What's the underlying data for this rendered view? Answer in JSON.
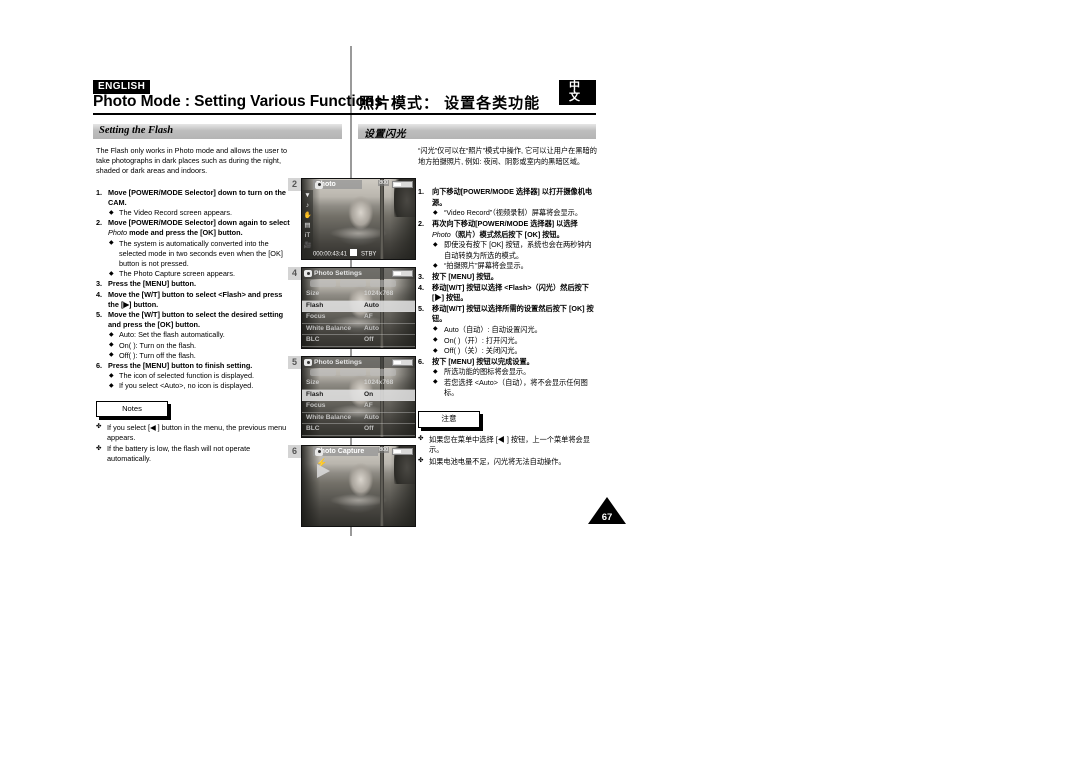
{
  "header": {
    "lang_en": "ENGLISH",
    "lang_cn": "中文",
    "title_en": "Photo Mode : Setting Various Functions",
    "title_cn": "照片模式： 设置各类功能"
  },
  "section": {
    "title_en": "Setting the Flash",
    "title_cn": "设置闪光"
  },
  "english": {
    "intro": "The Flash only works in Photo mode and allows the user to take photographs in dark places such as during the night, shaded or dark areas and indoors.",
    "steps": [
      {
        "num": "1.",
        "text": "Move [POWER/MODE Selector] down to turn on the CAM.",
        "subs": [
          "The Video Record screen appears."
        ]
      },
      {
        "num": "2.",
        "text_a": "Move [POWER/MODE Selector] down again to select ",
        "text_i": "Photo",
        "text_b": " mode and press the [OK] button.",
        "subs": [
          "The system is automatically converted into the selected mode in two seconds even when the [OK] button is not pressed.",
          "The Photo Capture screen appears."
        ]
      },
      {
        "num": "3.",
        "text": "Press the [MENU] button.",
        "subs": []
      },
      {
        "num": "4.",
        "text": "Move the [W/T] button to select <Flash> and press the [▶] button.",
        "subs": []
      },
      {
        "num": "5.",
        "text": "Move the [W/T] button to select the desired setting and press the [OK] button.",
        "subs": [
          "Auto: Set the flash automatically.",
          "On(  ): Turn on the flash.",
          "Off(  ): Turn off the flash."
        ]
      },
      {
        "num": "6.",
        "text": "Press the [MENU] button to finish setting.",
        "subs": [
          "The icon of selected function is displayed.",
          "If you select <Auto>, no icon is displayed."
        ]
      }
    ],
    "notes_label": "Notes",
    "notes": [
      "If you select [◀ ] button in the menu, the previous menu appears.",
      "If the battery is low, the flash will not operate automatically."
    ]
  },
  "chinese": {
    "intro": "“闪光”仅可以在“照片”模式中操作, 它可以让用户在黑暗的地方拍摄照片, 例如: 夜间、阴影或室内的黑暗区域。",
    "steps": [
      {
        "num": "1.",
        "text": "向下移动[POWER/MODE 选择器] 以打开摄像机电源。",
        "subs": [
          "“Video Record”（视频录制）屏幕将会显示。"
        ]
      },
      {
        "num": "2.",
        "text_a": "再次向下移动[POWER/MODE 选择器] 以选择",
        "text_i": "Photo",
        "text_b": "（照片）模式然后按下 [OK] 按钮。",
        "subs": [
          "即使没有按下 [OK] 按钮，系统也会在两秒钟内自动转换为所选的模式。",
          "“拍摄照片”屏幕将会显示。"
        ]
      },
      {
        "num": "3.",
        "text": "按下 [MENU] 按钮。",
        "subs": []
      },
      {
        "num": "4.",
        "text": "移动[W/T] 按钮以选择 <Flash>（闪光）然后按下[▶] 按钮。",
        "subs": []
      },
      {
        "num": "5.",
        "text": "移动[W/T] 按钮以选择所需的设置然后按下 [OK] 按钮。",
        "subs": [
          "Auto（自动）: 自动设置闪光。",
          "On(  )（开）: 打开闪光。",
          "Off(  )（关）: 关闭闪光。"
        ]
      },
      {
        "num": "6.",
        "text": "按下 [MENU] 按钮以完成设置。",
        "subs": [
          "所选功能的图标将会显示。",
          "若您选择 <Auto>（自动），将不会显示任何图标。"
        ]
      }
    ],
    "notes_label": "注意",
    "notes": [
      "如果您在菜单中选择 [◀ ] 按钮，上一个菜单将会显示。",
      "如果电池电量不足，闪光将无法自动操作。"
    ]
  },
  "screens": [
    {
      "step": "2",
      "type": "capture",
      "mode_label": "Photo",
      "resolution": "800",
      "timecode": "000:00:43:41",
      "status": "STBY",
      "side_icons": [
        "chevron-down-icon",
        "music-icon",
        "hand-icon",
        "file-icon",
        "text-icon",
        "movie-icon"
      ]
    },
    {
      "step": "4",
      "type": "menu",
      "title": "Photo Settings",
      "rows": [
        {
          "label": "Size",
          "value": "1024x768",
          "selected": false
        },
        {
          "label": "Flash",
          "value": "Auto",
          "selected": true
        },
        {
          "label": "Focus",
          "value": "AF",
          "selected": false
        },
        {
          "label": "White Balance",
          "value": "Auto",
          "selected": false
        },
        {
          "label": "BLC",
          "value": "Off",
          "selected": false
        }
      ]
    },
    {
      "step": "5",
      "type": "menu",
      "title": "Photo Settings",
      "rows": [
        {
          "label": "Size",
          "value": "1024x768",
          "selected": false
        },
        {
          "label": "Flash",
          "value": "On",
          "selected": true
        },
        {
          "label": "Focus",
          "value": "AF",
          "selected": false
        },
        {
          "label": "White Balance",
          "value": "Auto",
          "selected": false
        },
        {
          "label": "BLC",
          "value": "Off",
          "selected": false
        }
      ]
    },
    {
      "step": "6",
      "type": "capture",
      "mode_label": "Photo Capture",
      "resolution": "800",
      "timecode": "",
      "status": "",
      "side_icons": []
    }
  ],
  "page_number": "67"
}
